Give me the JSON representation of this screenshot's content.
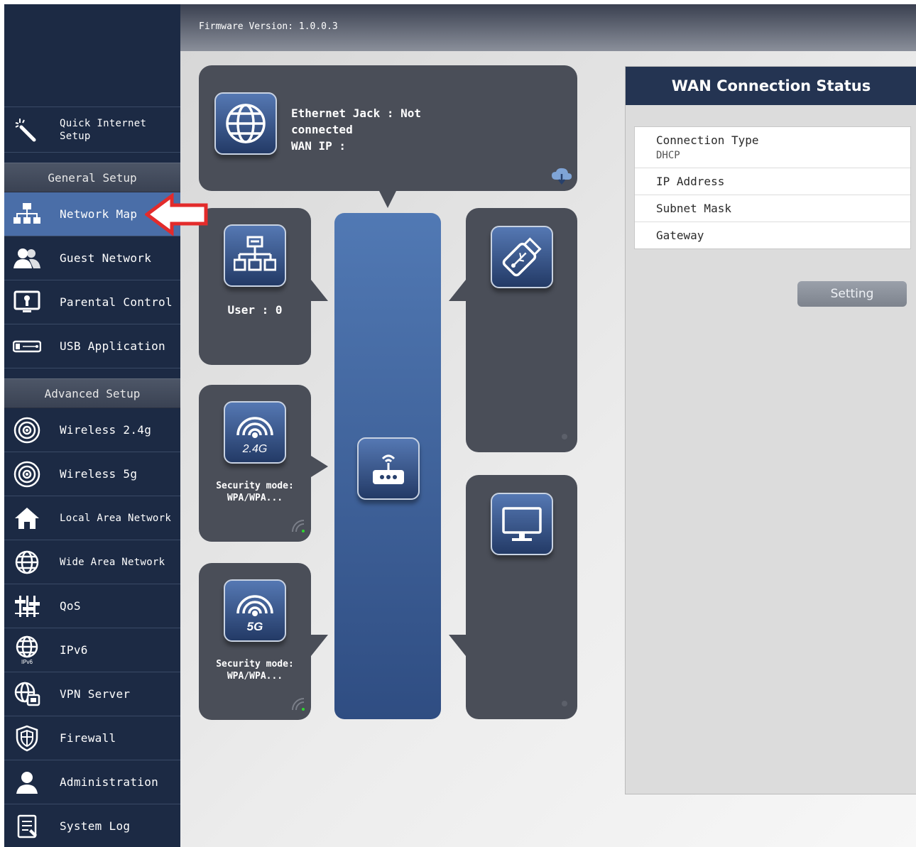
{
  "firmware": "Firmware Version: 1.0.0.3",
  "sidebar": {
    "quick_setup": "Quick Internet\nSetup",
    "general_header": "General Setup",
    "general_items": [
      {
        "label": "Network Map",
        "icon": "network-map-icon"
      },
      {
        "label": "Guest Network",
        "icon": "guest-network-icon"
      },
      {
        "label": "Parental Control",
        "icon": "parental-control-icon"
      },
      {
        "label": "USB Application",
        "icon": "usb-icon"
      }
    ],
    "advanced_header": "Advanced Setup",
    "advanced_items": [
      {
        "label": "Wireless 2.4g",
        "icon": "wireless-icon"
      },
      {
        "label": "Wireless 5g",
        "icon": "wireless-icon"
      },
      {
        "label": "Local Area Network",
        "icon": "home-icon"
      },
      {
        "label": "Wide Area Network",
        "icon": "globe-icon"
      },
      {
        "label": "QoS",
        "icon": "qos-icon"
      },
      {
        "label": "IPv6",
        "icon": "ipv6-icon",
        "badge": "IPv6"
      },
      {
        "label": "VPN Server",
        "icon": "vpn-icon"
      },
      {
        "label": "Firewall",
        "icon": "shield-icon"
      },
      {
        "label": "Administration",
        "icon": "user-icon"
      },
      {
        "label": "System Log",
        "icon": "log-icon"
      }
    ]
  },
  "map": {
    "internet": {
      "line1": "Ethernet Jack : Not",
      "line2": "connected",
      "line3": "WAN IP :"
    },
    "clients": {
      "label": "User : 0"
    },
    "wifi24": {
      "badge": "2.4G",
      "line1": "Security mode:",
      "line2": "WPA/WPA..."
    },
    "wifi5": {
      "badge": "5G",
      "line1": "Security mode:",
      "line2": "WPA/WPA..."
    }
  },
  "wan_status": {
    "title": "WAN Connection Status",
    "rows": [
      {
        "label": "Connection Type",
        "value": "DHCP"
      },
      {
        "label": "IP Address"
      },
      {
        "label": "Subnet Mask"
      },
      {
        "label": "Gateway"
      }
    ],
    "setting_button": "Setting"
  },
  "colors": {
    "sidebar": "#1c2a44",
    "active": "#4a6ea8",
    "arrow": "#e32b2b",
    "card": "#4a4e58"
  }
}
